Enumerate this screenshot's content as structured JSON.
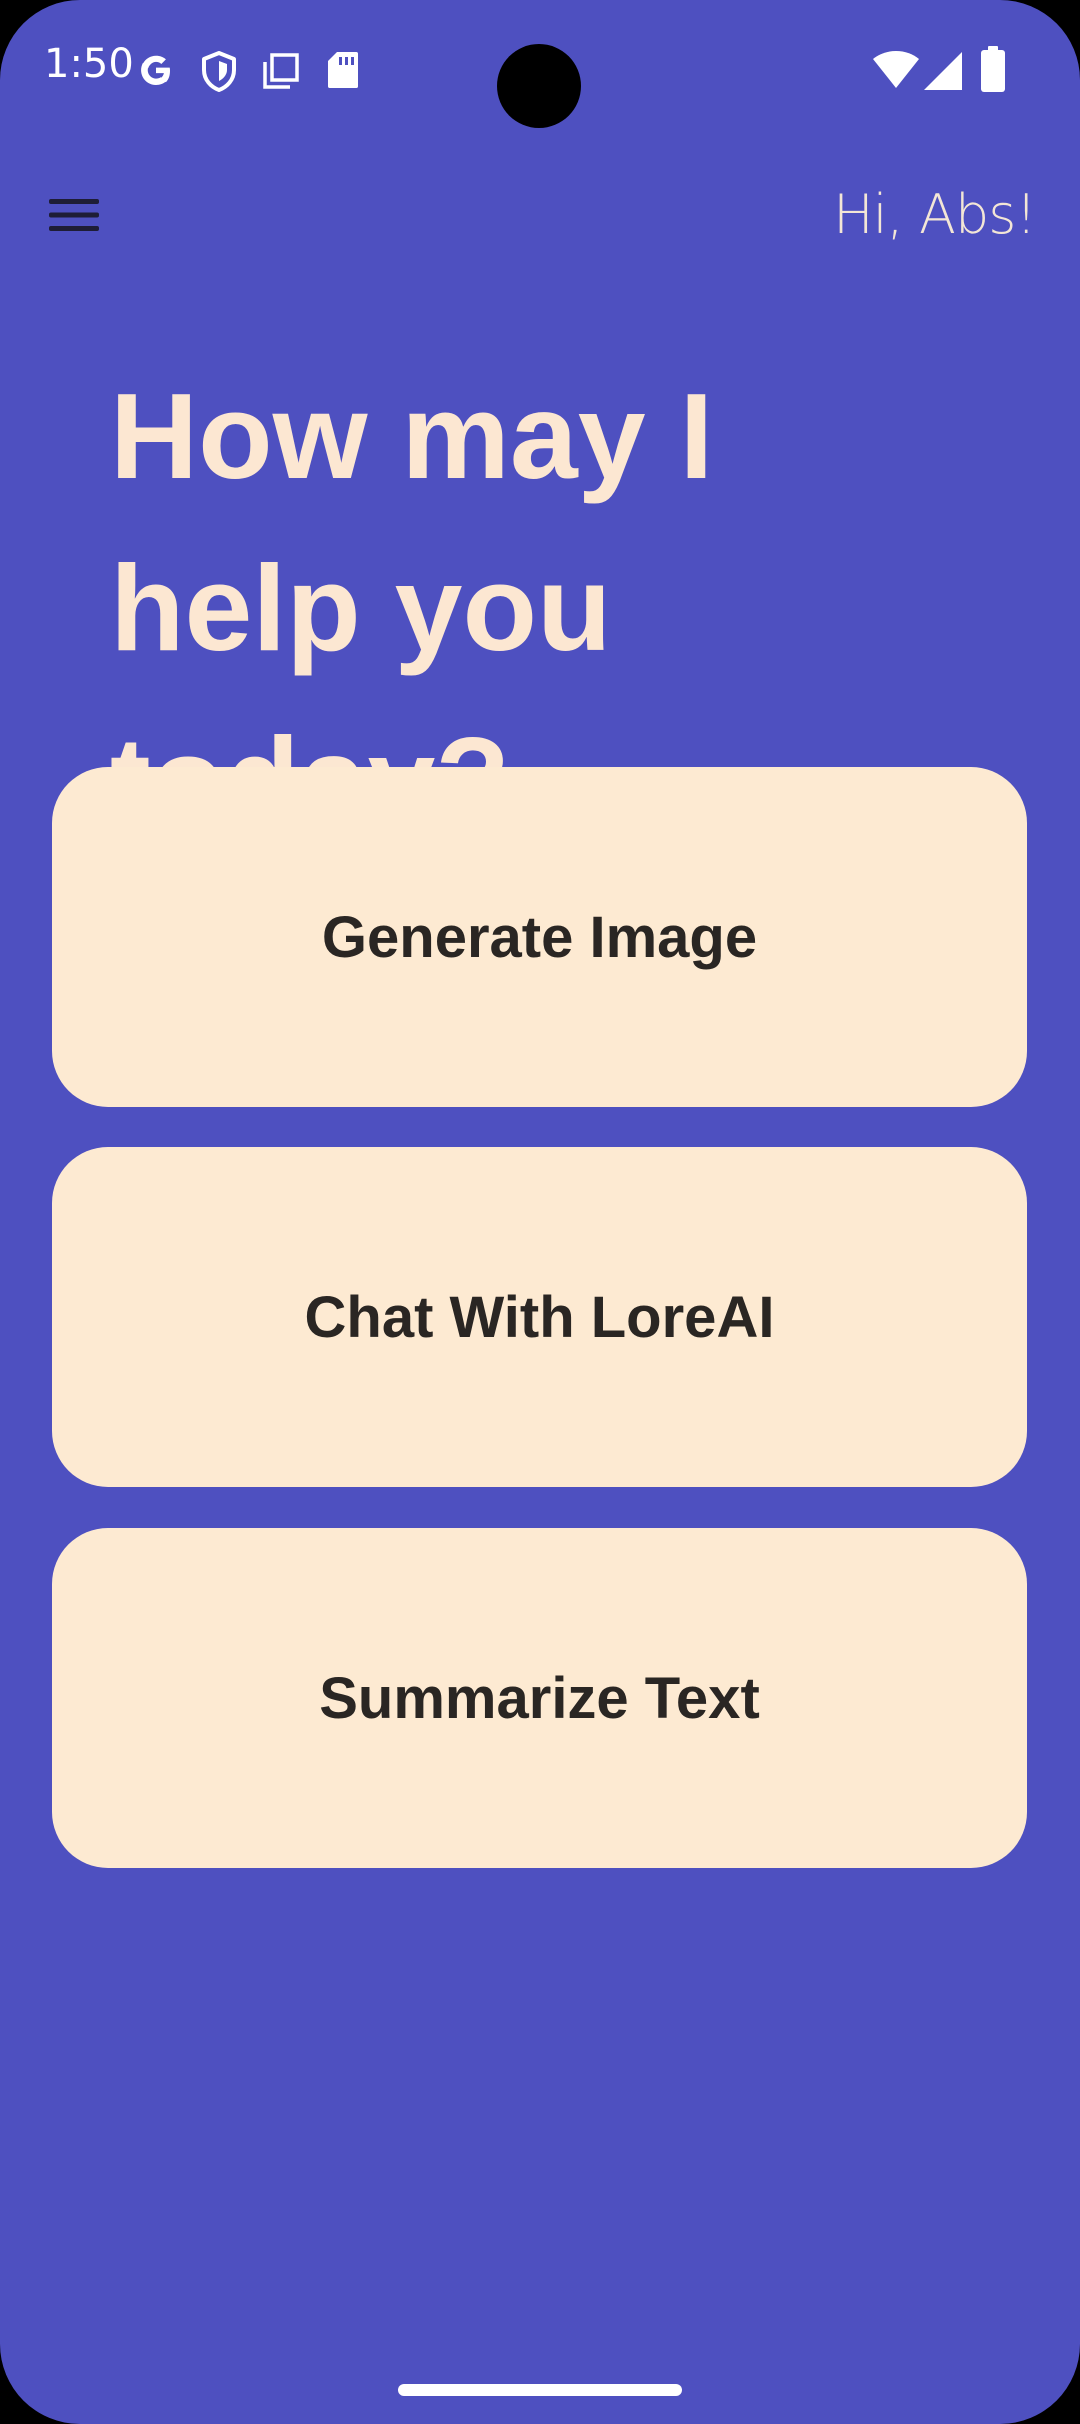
{
  "status_bar": {
    "time": "1:50",
    "icons": [
      "google-icon",
      "shield-icon",
      "notes-icon",
      "sd-card-icon",
      "wifi-icon",
      "signal-icon",
      "battery-icon"
    ]
  },
  "app_bar": {
    "menu_icon": "menu-icon",
    "greeting": "Hi, Abs!"
  },
  "headline": {
    "line1": "How may I",
    "line2": "help you today?"
  },
  "actions": [
    {
      "label": "Generate Image"
    },
    {
      "label": "Chat With LoreAI"
    },
    {
      "label": "Summarize Text"
    }
  ],
  "colors": {
    "background": "#4E50C0",
    "headline": "#FCE7D2",
    "card": "#FDEAD2",
    "card_text": "#2A2623"
  }
}
